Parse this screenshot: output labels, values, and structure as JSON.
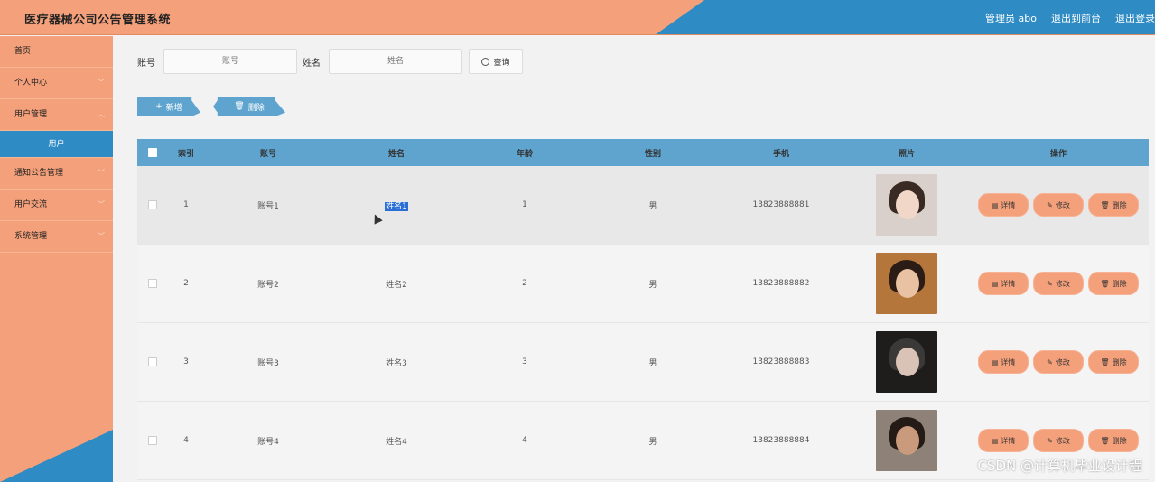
{
  "header": {
    "title": "医疗器械公司公告管理系统",
    "admin": "管理员 abo",
    "front": "退出到前台",
    "logout": "退出登录"
  },
  "sidebar": {
    "items": [
      {
        "label": "首页"
      },
      {
        "label": "个人中心"
      },
      {
        "label": "用户管理"
      },
      {
        "label": "用户"
      },
      {
        "label": "通知公告管理"
      },
      {
        "label": "用户交流"
      },
      {
        "label": "系统管理"
      }
    ]
  },
  "search": {
    "account_label": "账号",
    "account_placeholder": "账号",
    "name_label": "姓名",
    "name_placeholder": "姓名",
    "button": "查询"
  },
  "actions": {
    "add": "新增",
    "delete": "删除"
  },
  "table": {
    "headers": [
      "索引",
      "账号",
      "姓名",
      "年龄",
      "性别",
      "手机",
      "照片",
      "操作"
    ],
    "rows": [
      {
        "idx": "1",
        "account": "账号1",
        "name": "姓名1",
        "age": "1",
        "sex": "男",
        "phone": "13823888881"
      },
      {
        "idx": "2",
        "account": "账号2",
        "name": "姓名2",
        "age": "2",
        "sex": "男",
        "phone": "13823888882"
      },
      {
        "idx": "3",
        "account": "账号3",
        "name": "姓名3",
        "age": "3",
        "sex": "男",
        "phone": "13823888883"
      },
      {
        "idx": "4",
        "account": "账号4",
        "name": "姓名4",
        "age": "4",
        "sex": "男",
        "phone": "13823888884"
      }
    ],
    "ops": {
      "detail": "详情",
      "edit": "修改",
      "delete": "删除"
    }
  },
  "watermark": "CSDN @计算机毕业设计程"
}
